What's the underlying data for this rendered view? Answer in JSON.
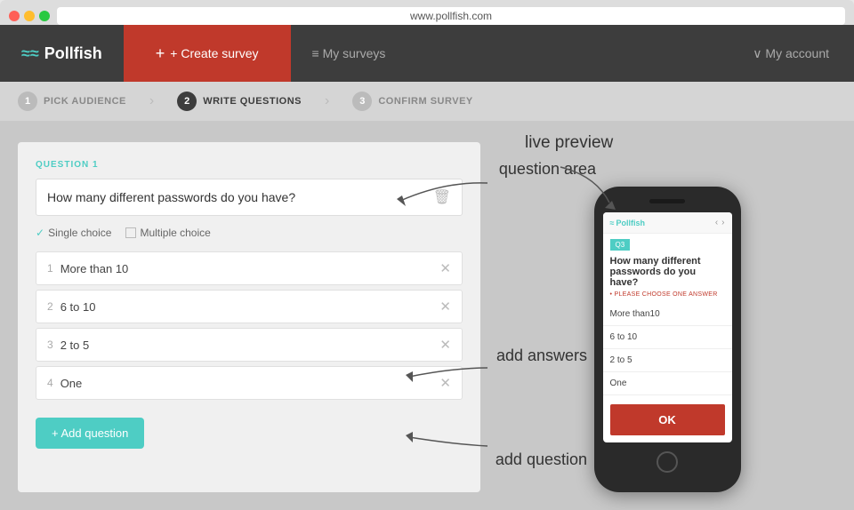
{
  "browser": {
    "url": "www.pollfish.com"
  },
  "nav": {
    "logo": "Pollfish",
    "create_label": "+ Create survey",
    "surveys_label": "≡  My surveys",
    "account_label": "∨  My account"
  },
  "steps": [
    {
      "number": "1",
      "label": "PICK AUDIENCE",
      "active": false
    },
    {
      "number": "2",
      "label": "WRITE QUESTIONS",
      "active": true
    },
    {
      "number": "3",
      "label": "CONFIRM SURVEY",
      "active": false
    }
  ],
  "question": {
    "label": "QUESTION 1",
    "text": "How many different passwords do you have?",
    "choice_single": "Single choice",
    "choice_multiple": "Multiple choice"
  },
  "answers": [
    {
      "num": "1",
      "text": "More than 10"
    },
    {
      "num": "2",
      "text": "6 to 10"
    },
    {
      "num": "3",
      "text": "2 to 5"
    },
    {
      "num": "4",
      "text": "One"
    }
  ],
  "add_question_label": "+ Add question",
  "annotations": {
    "live_preview": "live preview",
    "question_area": "question area",
    "add_answers": "add answers",
    "add_question": "add question"
  },
  "phone": {
    "logo": "Pollfish",
    "q_num": "Q3",
    "q_text": "How many different passwords do you have?",
    "please": "• PLEASE CHOOSE ONE ANSWER",
    "answers": [
      "More than10",
      "6 to 10",
      "2 to 5",
      "One"
    ],
    "ok_label": "OK"
  }
}
